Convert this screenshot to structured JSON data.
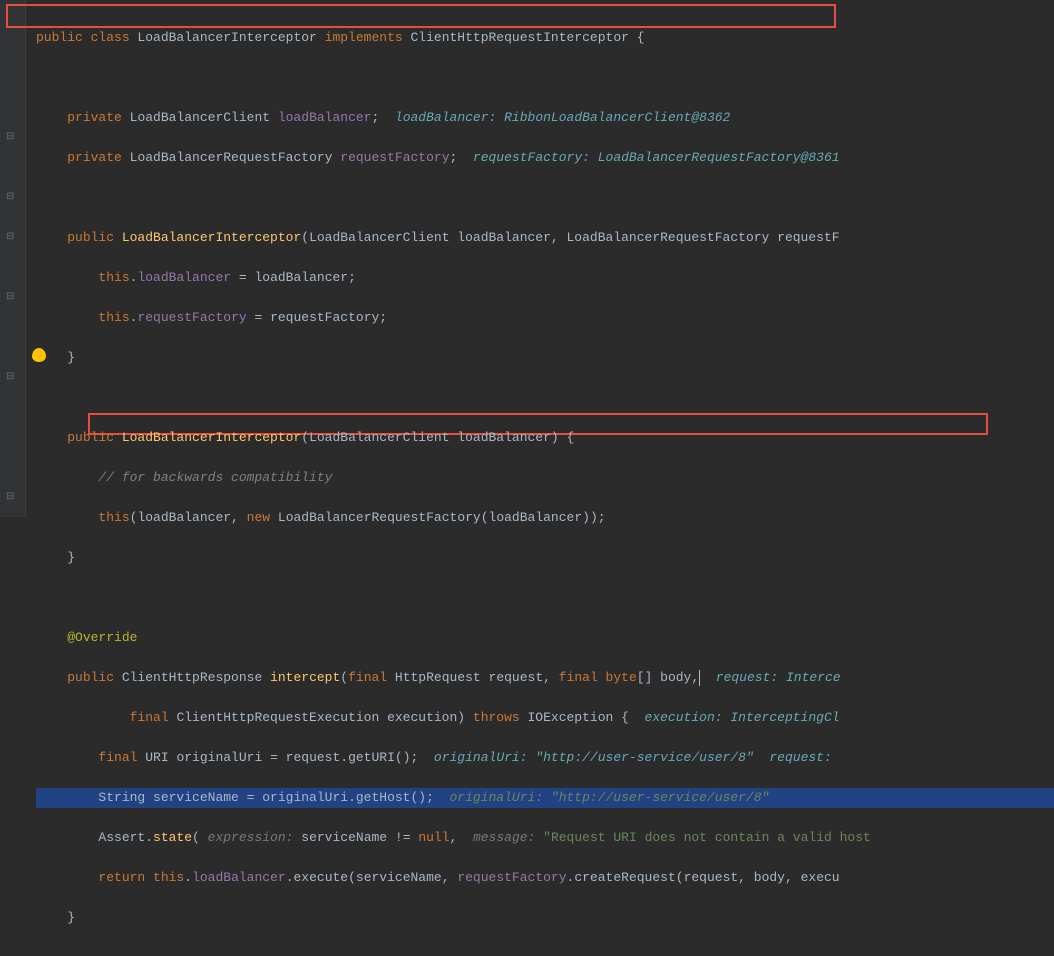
{
  "code": {
    "l1_kw1": "public class ",
    "l1_cls": "LoadBalancerInterceptor ",
    "l1_kw2": "implements ",
    "l1_impl": "ClientHttpRequestInterceptor {",
    "l3_kw": "private ",
    "l3_type": "LoadBalancerClient ",
    "l3_field": "loadBalancer",
    "l3_semi": ";  ",
    "l3_hint": "loadBalancer: RibbonLoadBalancerClient@8362",
    "l4_kw": "private ",
    "l4_type": "LoadBalancerRequestFactory ",
    "l4_field": "requestFactory",
    "l4_semi": ";  ",
    "l4_hint": "requestFactory: LoadBalancerRequestFactory@8361",
    "l6_kw": "public ",
    "l6_ctor": "LoadBalancerInterceptor",
    "l6_params": "(LoadBalancerClient loadBalancer, LoadBalancerRequestFactory requestF",
    "l7_this": "this",
    "l7_dot": ".",
    "l7_field": "loadBalancer",
    "l7_rest": " = loadBalancer;",
    "l8_this": "this",
    "l8_dot": ".",
    "l8_field": "requestFactory",
    "l8_rest": " = requestFactory;",
    "l9_brace": "}",
    "l11_kw": "public ",
    "l11_ctor": "LoadBalancerInterceptor",
    "l11_params": "(LoadBalancerClient loadBalancer) {",
    "l12_comment": "// for backwards compatibility",
    "l13_this": "this",
    "l13_rest1": "(loadBalancer, ",
    "l13_kw": "new ",
    "l13_rest2": "LoadBalancerRequestFactory(loadBalancer));",
    "l14_brace": "}",
    "l16_anno": "@Override",
    "l17_kw": "public ",
    "l17_type": "ClientHttpResponse ",
    "l17_method": "intercept",
    "l17_p1": "(",
    "l17_kw2": "final ",
    "l17_p2": "HttpRequest request, ",
    "l17_kw3": "final byte",
    "l17_p3": "[] body,",
    "l17_hint": "  request: Interce",
    "l18_kw": "final ",
    "l18_p1": "ClientHttpRequestExecution execution) ",
    "l18_kw2": "throws ",
    "l18_p2": "IOException {  ",
    "l18_hint": "execution: InterceptingCl",
    "l19_kw": "final ",
    "l19_type": "URI ",
    "l19_var": "originalUri = request.getURI();  ",
    "l19_hint": "originalUri: \"http://user-service/user/8\"  request: ",
    "l20_type": "String ",
    "l20_var": "serviceName = originalUri.getHost();  ",
    "l20_hint": "originalUri: \"http://user-service/user/8\"",
    "l21_p1": "Assert.",
    "l21_m": "state",
    "l21_p2": "( ",
    "l21_h1": "expression: ",
    "l21_p3": "serviceName != ",
    "l21_kw": "null",
    "l21_p4": ",  ",
    "l21_h2": "message: ",
    "l21_str": "\"Request URI does not contain a valid host",
    "l22_kw": "return this",
    "l22_dot": ".",
    "l22_field": "loadBalancer",
    "l22_p1": ".execute(serviceName, ",
    "l22_field2": "requestFactory",
    "l22_p2": ".createRequest(request, body, execu",
    "l23_brace": "}"
  },
  "indent": {
    "i1": "    ",
    "i2": "        ",
    "i3": "            "
  }
}
